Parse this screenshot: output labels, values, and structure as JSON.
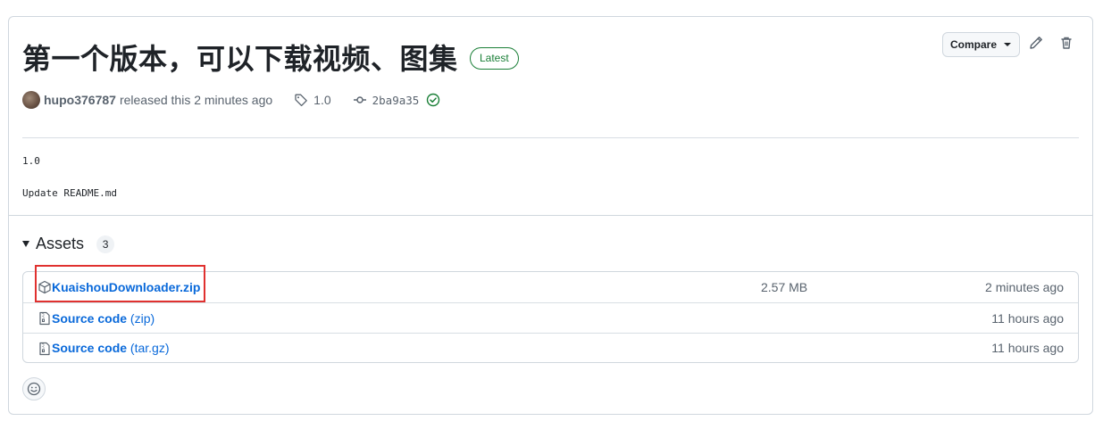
{
  "release": {
    "title": "第一个版本，可以下载视频、图集",
    "latest_badge": "Latest",
    "compare_label": "Compare",
    "author": "hupo376787",
    "released_text": "released this 2 minutes ago",
    "tag": "1.0",
    "commit_sha": "2ba9a35",
    "body_lines": [
      "1.0",
      "Update README.md"
    ]
  },
  "assets": {
    "title": "Assets",
    "count": "3",
    "items": [
      {
        "name": "KuaishouDownloader.zip",
        "ext": "",
        "size": "2.57 MB",
        "time": "2 minutes ago",
        "icon": "package-icon"
      },
      {
        "name": "Source code",
        "ext": "(zip)",
        "size": "",
        "time": "11 hours ago",
        "icon": "file-zip-icon"
      },
      {
        "name": "Source code",
        "ext": "(tar.gz)",
        "size": "",
        "time": "11 hours ago",
        "icon": "file-zip-icon"
      }
    ]
  },
  "colors": {
    "link": "#0969da",
    "latest_green": "#1a7f37",
    "highlight_red": "#e0312f",
    "border": "#d0d7de"
  }
}
